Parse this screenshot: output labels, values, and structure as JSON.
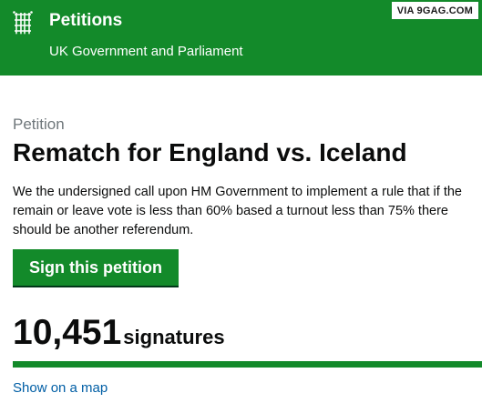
{
  "header": {
    "site_title": "Petitions",
    "site_subtitle": "UK Government and Parliament",
    "crest_icon": "portcullis-icon",
    "background_color": "#138a2a"
  },
  "watermark": {
    "text": "VIA 9GAG.COM"
  },
  "petition": {
    "label": "Petition",
    "title": "Rematch for England vs. Iceland",
    "description": "We the undersigned call upon HM Government to implement a rule that if the remain or leave vote is less than 60% based a turnout less than 75% there should be another referendum.",
    "sign_button_label": "Sign this petition",
    "signature_count": "10,451",
    "signature_label": "signatures",
    "progress_fraction": 1.0,
    "map_link_label": "Show on a map"
  }
}
